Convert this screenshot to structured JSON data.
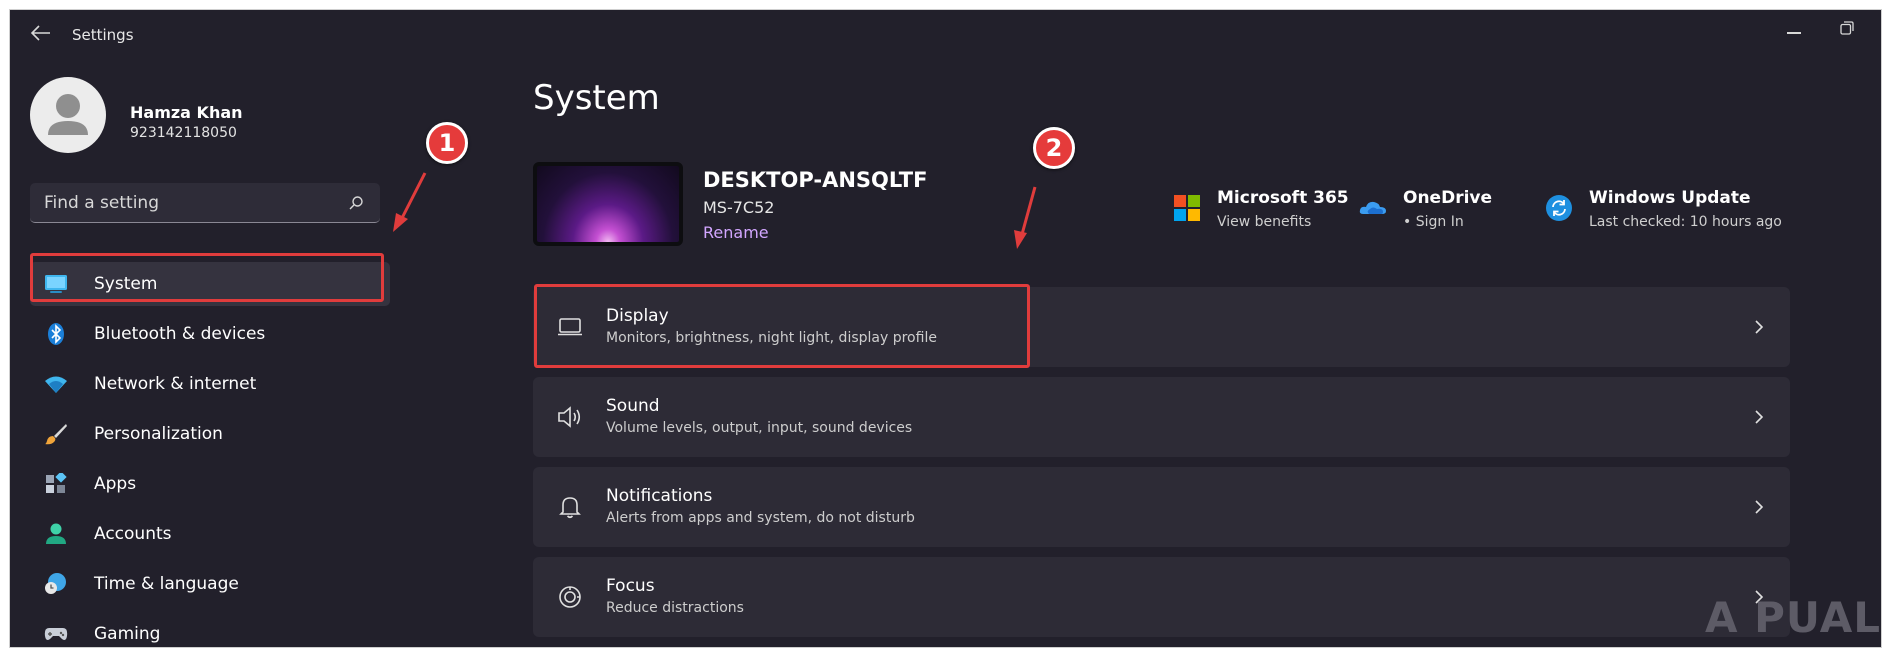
{
  "window": {
    "title": "Settings"
  },
  "profile": {
    "name": "Hamza Khan",
    "phone": "923142118050"
  },
  "search": {
    "placeholder": "Find a setting"
  },
  "sidebar": {
    "items": [
      {
        "label": "System",
        "icon": "system-icon",
        "active": true
      },
      {
        "label": "Bluetooth & devices",
        "icon": "bluetooth-icon"
      },
      {
        "label": "Network & internet",
        "icon": "wifi-icon"
      },
      {
        "label": "Personalization",
        "icon": "brush-icon"
      },
      {
        "label": "Apps",
        "icon": "apps-icon"
      },
      {
        "label": "Accounts",
        "icon": "accounts-icon"
      },
      {
        "label": "Time & language",
        "icon": "globe-clock-icon"
      },
      {
        "label": "Gaming",
        "icon": "gamepad-icon"
      }
    ]
  },
  "main": {
    "title": "System",
    "device": {
      "name": "DESKTOP-ANSQLTF",
      "model": "MS-7C52",
      "rename_label": "Rename"
    },
    "quick_links": [
      {
        "title": "Microsoft 365",
        "subtitle": "View benefits",
        "icon": "microsoft-logo-icon"
      },
      {
        "title": "OneDrive",
        "subtitle": "• Sign In",
        "icon": "onedrive-cloud-icon"
      },
      {
        "title": "Windows Update",
        "subtitle": "Last checked: 10 hours ago",
        "icon": "windows-update-icon"
      }
    ],
    "cards": [
      {
        "title": "Display",
        "subtitle": "Monitors, brightness, night light, display profile",
        "icon": "monitor-icon"
      },
      {
        "title": "Sound",
        "subtitle": "Volume levels, output, input, sound devices",
        "icon": "speaker-icon"
      },
      {
        "title": "Notifications",
        "subtitle": "Alerts from apps and system, do not disturb",
        "icon": "bell-icon"
      },
      {
        "title": "Focus",
        "subtitle": "Reduce distractions",
        "icon": "focus-icon"
      }
    ]
  },
  "annotations": [
    {
      "number": "1",
      "color": "#e53b3b"
    },
    {
      "number": "2",
      "color": "#e53b3b"
    }
  ],
  "watermark": {
    "text": "A PUALS"
  },
  "colors": {
    "background": "#22202b",
    "card": "#2d2b36",
    "accent": "#4cc2ff",
    "link": "#d2a6ff",
    "annotation": "#e03c3c"
  }
}
